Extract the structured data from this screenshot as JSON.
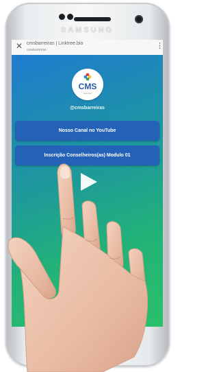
{
  "device": {
    "brand": "SAMSUNG"
  },
  "browser": {
    "close_icon": "close-icon",
    "title": "cmsbarreiras | Linktree.bio",
    "url": "cmsbarreiras",
    "menu_icon": "more-vert-icon"
  },
  "page": {
    "logo_text": "CMS",
    "logo_sub": "barreiras",
    "handle": "@cmsbarreiras",
    "links": [
      {
        "label": "Nosso Canal no YouTube"
      },
      {
        "label": "Inscrição Conselheiros(as) Modulo 01"
      }
    ],
    "play_icon": "play-icon"
  },
  "colors": {
    "gradient_start": "#1f7bcf",
    "gradient_end": "#2bc06a",
    "button": "#2462b8",
    "logo_blue": "#2a5aa7"
  }
}
